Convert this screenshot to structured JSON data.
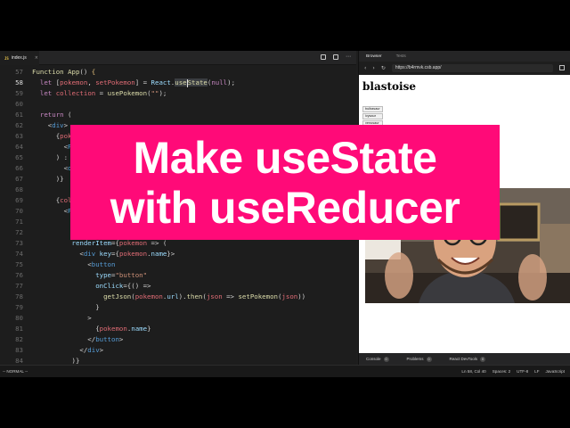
{
  "editor": {
    "file_tab": {
      "icon": "js-file-icon",
      "glyph": "JS",
      "label": "index.js"
    },
    "lines": [
      {
        "n": "57",
        "tokens": [
          [
            "fn",
            "Function"
          ],
          [
            "tx",
            " "
          ],
          [
            "fn",
            "App"
          ],
          [
            "tx",
            "() "
          ],
          [
            "br",
            "{"
          ]
        ]
      },
      {
        "n": "58",
        "current": true,
        "tokens": [
          [
            "tx",
            "  "
          ],
          [
            "kw",
            "let"
          ],
          [
            "tx",
            " ["
          ],
          [
            "id",
            "pokemon"
          ],
          [
            "tx",
            ", "
          ],
          [
            "id",
            "setPokemon"
          ],
          [
            "tx",
            "] = "
          ],
          [
            "pr",
            "React"
          ],
          [
            "tx",
            "."
          ],
          [
            "hl",
            "useState"
          ],
          [
            "tx",
            "("
          ],
          [
            "kw",
            "null"
          ],
          [
            "tx",
            ");"
          ]
        ]
      },
      {
        "n": "59",
        "tokens": [
          [
            "tx",
            "  "
          ],
          [
            "kw",
            "let"
          ],
          [
            "tx",
            " "
          ],
          [
            "id",
            "collection"
          ],
          [
            "tx",
            " = "
          ],
          [
            "fn",
            "usePokemon"
          ],
          [
            "tx",
            "("
          ],
          [
            "st",
            "\"\""
          ],
          [
            "tx",
            ");"
          ]
        ]
      },
      {
        "n": "60",
        "tokens": []
      },
      {
        "n": "61",
        "tokens": [
          [
            "tx",
            "  "
          ],
          [
            "kw",
            "return"
          ],
          [
            "tx",
            " ("
          ]
        ]
      },
      {
        "n": "62",
        "tokens": [
          [
            "tx",
            "    <"
          ],
          [
            "tag",
            "div"
          ],
          [
            "tx",
            ">"
          ]
        ]
      },
      {
        "n": "63",
        "tokens": [
          [
            "tx",
            "      {"
          ],
          [
            "id",
            "pokemon"
          ]
        ]
      },
      {
        "n": "64",
        "tokens": [
          [
            "tx",
            "        <"
          ],
          [
            "tag",
            "P"
          ]
        ]
      },
      {
        "n": "65",
        "tokens": [
          [
            "tx",
            "      ) :"
          ]
        ]
      },
      {
        "n": "66",
        "tokens": [
          [
            "tx",
            "        <"
          ],
          [
            "tag",
            "d"
          ]
        ]
      },
      {
        "n": "67",
        "tokens": [
          [
            "tx",
            "      )}"
          ]
        ]
      },
      {
        "n": "68",
        "tokens": []
      },
      {
        "n": "69",
        "tokens": [
          [
            "tx",
            "      {"
          ],
          [
            "id",
            "col"
          ]
        ]
      },
      {
        "n": "70",
        "tokens": [
          [
            "tx",
            "        <"
          ],
          [
            "tag",
            "P"
          ]
        ]
      },
      {
        "n": "71",
        "tokens": []
      },
      {
        "n": "72",
        "tokens": []
      },
      {
        "n": "73",
        "tokens": [
          [
            "tx",
            "          "
          ],
          [
            "pr",
            "renderItem"
          ],
          [
            "tx",
            "={"
          ],
          [
            "id",
            "pokemon"
          ],
          [
            "tx",
            " => ("
          ]
        ]
      },
      {
        "n": "74",
        "tokens": [
          [
            "tx",
            "            <"
          ],
          [
            "tag",
            "div"
          ],
          [
            "tx",
            " "
          ],
          [
            "pr",
            "key"
          ],
          [
            "tx",
            "={"
          ],
          [
            "id",
            "pokemon"
          ],
          [
            "tx",
            "."
          ],
          [
            "pr",
            "name"
          ],
          [
            "tx",
            "}>"
          ]
        ]
      },
      {
        "n": "75",
        "tokens": [
          [
            "tx",
            "              <"
          ],
          [
            "tag",
            "button"
          ]
        ]
      },
      {
        "n": "76",
        "tokens": [
          [
            "tx",
            "                "
          ],
          [
            "pr",
            "type"
          ],
          [
            "tx",
            "="
          ],
          [
            "st",
            "\"button\""
          ]
        ]
      },
      {
        "n": "77",
        "tokens": [
          [
            "tx",
            "                "
          ],
          [
            "pr",
            "onClick"
          ],
          [
            "tx",
            "={() =>"
          ]
        ]
      },
      {
        "n": "78",
        "tokens": [
          [
            "tx",
            "                  "
          ],
          [
            "fn",
            "getJson"
          ],
          [
            "tx",
            "("
          ],
          [
            "id",
            "pokemon"
          ],
          [
            "tx",
            "."
          ],
          [
            "pr",
            "url"
          ],
          [
            "tx",
            ")."
          ],
          [
            "fn",
            "then"
          ],
          [
            "tx",
            "("
          ],
          [
            "id",
            "json"
          ],
          [
            "tx",
            " => "
          ],
          [
            "fn",
            "setPokemon"
          ],
          [
            "tx",
            "("
          ],
          [
            "id",
            "json"
          ],
          [
            "tx",
            "))"
          ]
        ]
      },
      {
        "n": "79",
        "tokens": [
          [
            "tx",
            "                }"
          ]
        ]
      },
      {
        "n": "80",
        "tokens": [
          [
            "tx",
            "              >"
          ]
        ]
      },
      {
        "n": "81",
        "tokens": [
          [
            "tx",
            "                {"
          ],
          [
            "id",
            "pokemon"
          ],
          [
            "tx",
            "."
          ],
          [
            "pr",
            "name"
          ],
          [
            "tx",
            "}"
          ]
        ]
      },
      {
        "n": "82",
        "tokens": [
          [
            "tx",
            "              </"
          ],
          [
            "tag",
            "button"
          ],
          [
            "tx",
            ">"
          ]
        ]
      },
      {
        "n": "83",
        "tokens": [
          [
            "tx",
            "            </"
          ],
          [
            "tag",
            "div"
          ],
          [
            "tx",
            ">"
          ]
        ]
      },
      {
        "n": "84",
        "tokens": [
          [
            "tx",
            "          )}"
          ]
        ]
      }
    ]
  },
  "statusbar": {
    "mode": "-- NORMAL --",
    "position": "Ln 58, Col 40",
    "spaces": "Spaces: 2",
    "encoding": "UTF-8",
    "eol": "LF",
    "language": "JavaScript"
  },
  "browser": {
    "tabs": [
      "Browser",
      "Tests"
    ],
    "url": "https://b4rmvk.csb.app/",
    "page_title": "blastoise",
    "list_items": [
      "bulbasaur",
      "ivysaur",
      "venusaur"
    ],
    "devtools": [
      {
        "label": "Console",
        "count": "0"
      },
      {
        "label": "Problems",
        "count": "0"
      },
      {
        "label": "React DevTools",
        "count": "0"
      }
    ]
  },
  "banner": {
    "line1": "Make useState",
    "line2": "with useReducer"
  },
  "colors": {
    "banner_bg": "#ff0a78",
    "editor_bg": "#1d1d1d",
    "keyword": "#c586c0",
    "function": "#dcdcaa",
    "variable": "#e06c75",
    "string": "#ce9178",
    "property": "#9cdcfe"
  }
}
